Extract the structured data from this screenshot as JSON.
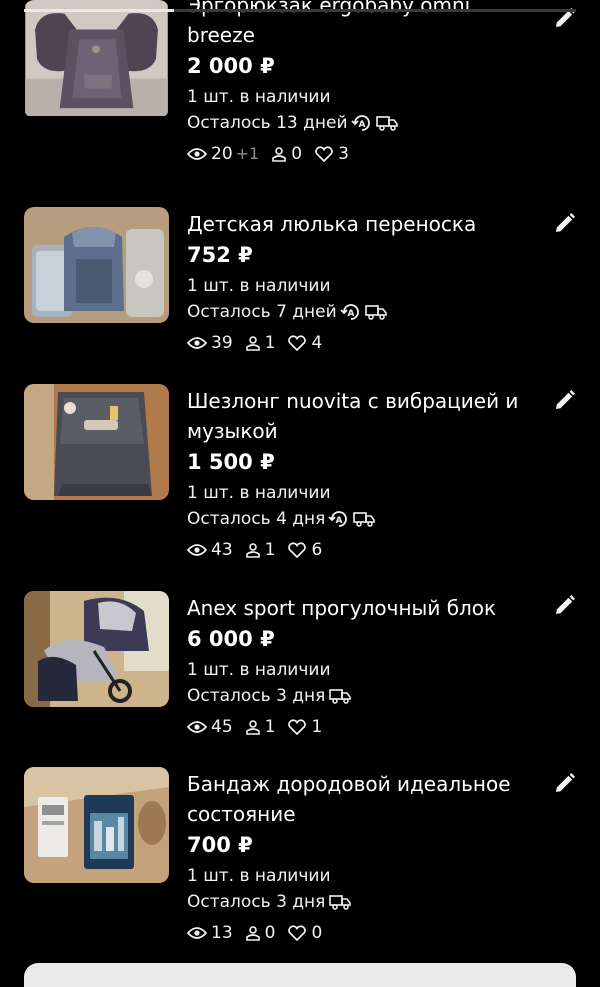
{
  "listings": [
    {
      "title": "Эргорюкзак ergobaby omni breeze",
      "price": "2 000 ₽",
      "stock": "1 шт. в наличии",
      "remaining": "Осталось 13 дней",
      "autorenew_icon": "autorenew-icon",
      "delivery_icon": "delivery-truck-icon",
      "views": "20",
      "views_delta": "+1",
      "contacts": "0",
      "favorites": "3"
    },
    {
      "title": "Детская люлька переноска",
      "price": "752 ₽",
      "stock": "1 шт. в наличии",
      "remaining": "Осталось 7 дней",
      "autorenew_icon": "autorenew-icon",
      "delivery_icon": "delivery-truck-icon",
      "views": "39",
      "contacts": "1",
      "favorites": "4"
    },
    {
      "title": "Шезлонг nuovita с вибрацией и музыкой",
      "price": "1 500 ₽",
      "stock": "1 шт. в наличии",
      "remaining": "Осталось 4 дня",
      "autorenew_icon": "autorenew-icon",
      "delivery_icon": "delivery-truck-icon",
      "views": "43",
      "contacts": "1",
      "favorites": "6"
    },
    {
      "title": "Anex sport прогулочный блок",
      "price": "6 000 ₽",
      "stock": "1 шт. в наличии",
      "remaining": "Осталось 3 дня",
      "delivery_icon": "delivery-truck-icon",
      "views": "45",
      "contacts": "1",
      "favorites": "1"
    },
    {
      "title": "Бандаж дородовой идеальное состояние",
      "price": "700 ₽",
      "stock": "1 шт. в наличии",
      "remaining": "Осталось 3 дня",
      "delivery_icon": "delivery-truck-icon",
      "views": "13",
      "contacts": "0",
      "favorites": "0"
    }
  ],
  "icons": {
    "views": "eye-icon",
    "contacts": "person-icon",
    "favorites": "heart-icon",
    "edit": "pencil-icon"
  },
  "colors": {
    "background": "#000000",
    "text": "#ffffff",
    "muted": "#8c8c8c"
  }
}
